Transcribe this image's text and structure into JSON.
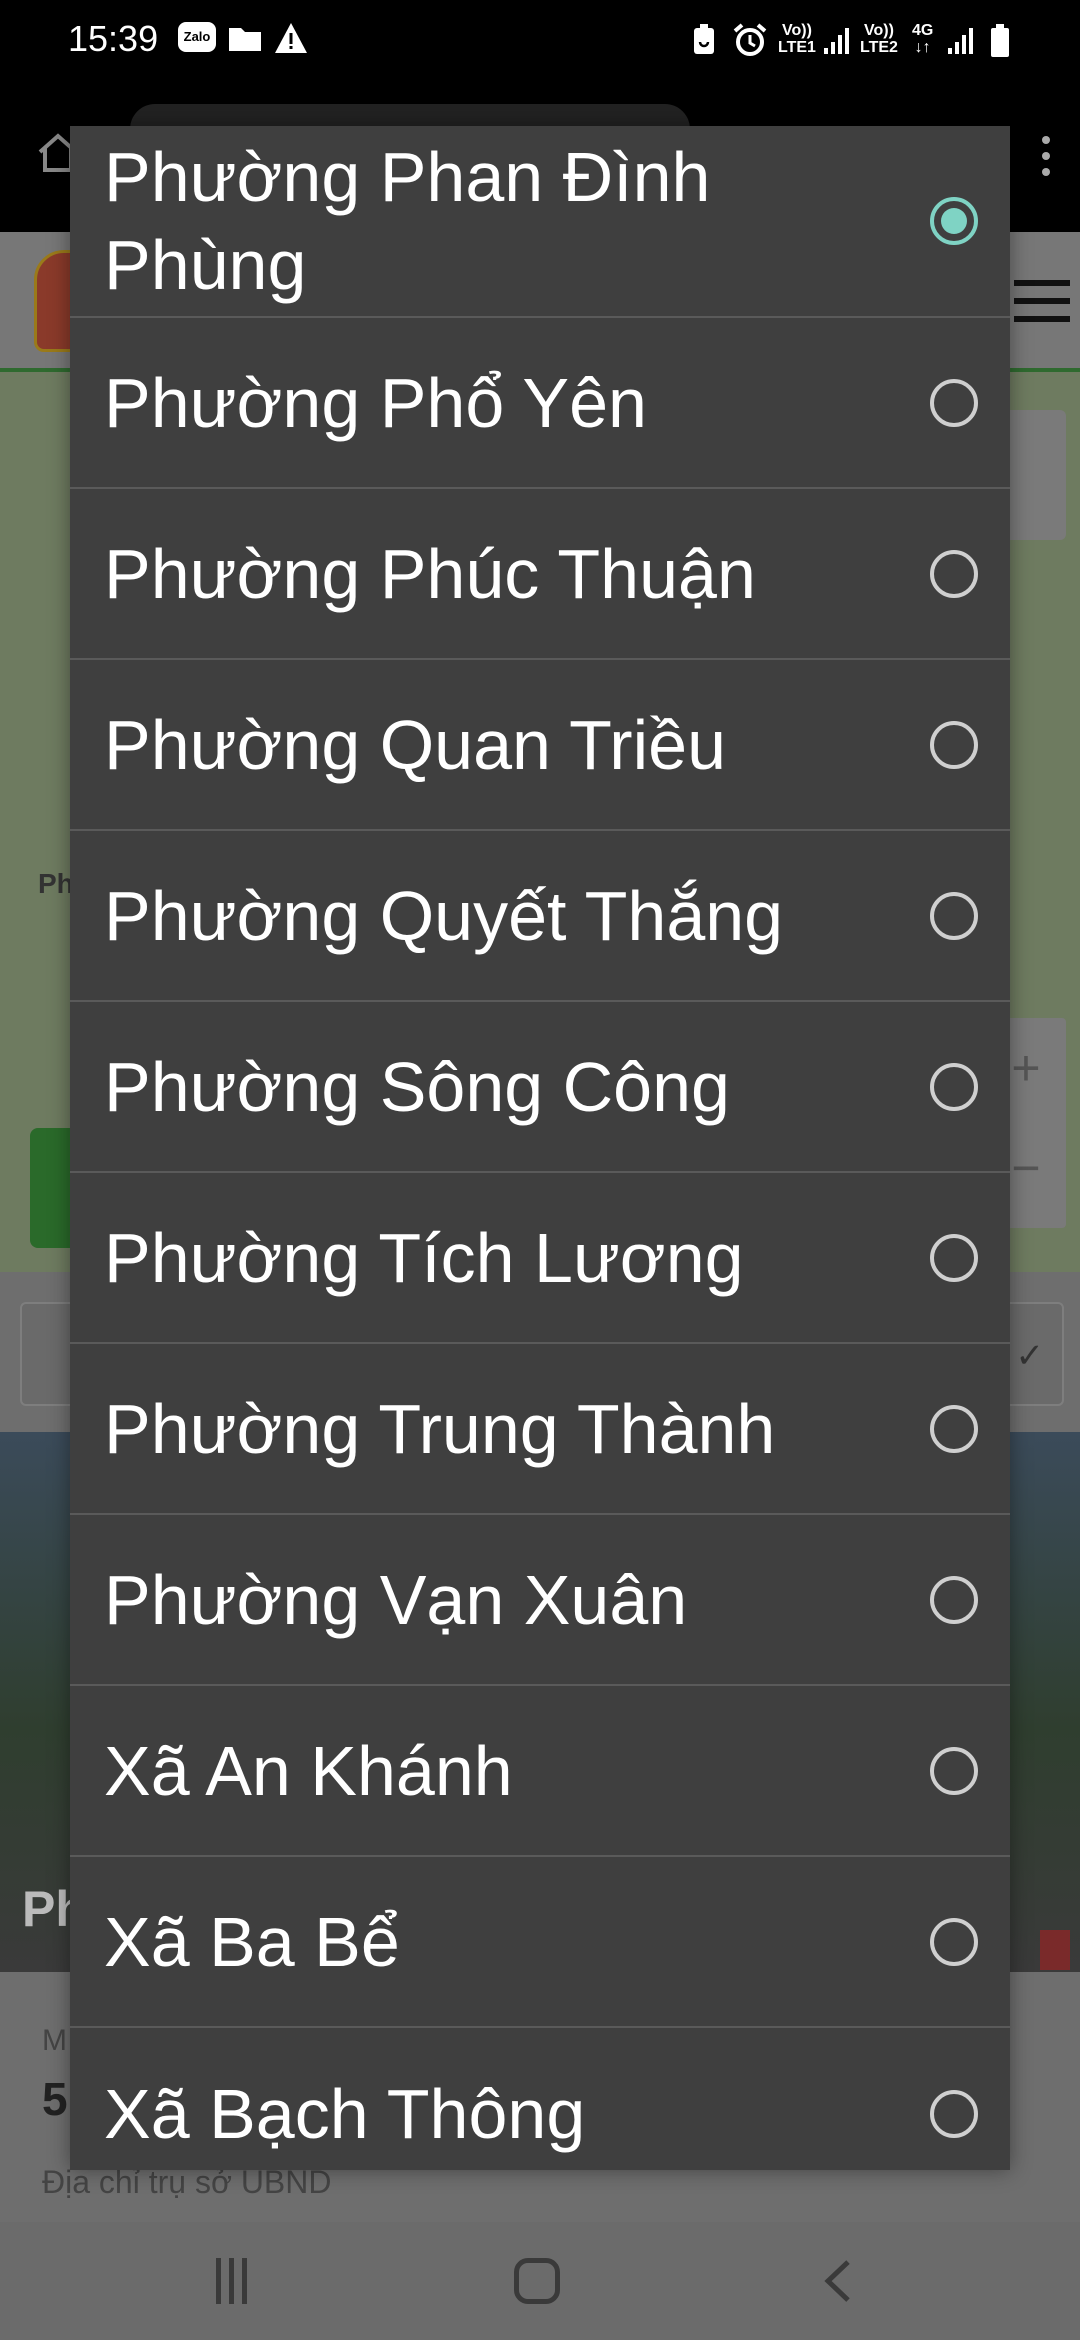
{
  "status_bar": {
    "time": "15:39",
    "notification_icons": [
      "zalo-icon",
      "folder-icon",
      "warning-icon"
    ],
    "right_icons": [
      "battery-saver-icon",
      "alarm-icon",
      "signal-icon",
      "signal-icon",
      "battery-icon"
    ],
    "sim1_label_top": "Vo))",
    "sim1_label_bottom": "LTE1",
    "sim2_label_top": "Vo))",
    "sim2_label_bottom": "LTE2",
    "network_type": "4G"
  },
  "background": {
    "map_label_partial": "Ph",
    "photo_title_partial": "Ph",
    "info_small_partial": "M",
    "info_big_partial": "5",
    "info_address_label": "Địa chỉ trụ sở UBND"
  },
  "dialog": {
    "options": [
      {
        "label": "Phường Phan Đình Phùng",
        "selected": true
      },
      {
        "label": "Phường Phổ Yên",
        "selected": false
      },
      {
        "label": "Phường Phúc Thuận",
        "selected": false
      },
      {
        "label": "Phường Quan Triều",
        "selected": false
      },
      {
        "label": "Phường Quyết Thắng",
        "selected": false
      },
      {
        "label": "Phường Sông Công",
        "selected": false
      },
      {
        "label": "Phường Tích Lương",
        "selected": false
      },
      {
        "label": "Phường Trung Thành",
        "selected": false
      },
      {
        "label": "Phường Vạn Xuân",
        "selected": false
      },
      {
        "label": "Xã An Khánh",
        "selected": false
      },
      {
        "label": "Xã Ba Bể",
        "selected": false
      },
      {
        "label": "Xã Bạch Thông",
        "selected": false
      }
    ]
  },
  "colors": {
    "dialog_background": "#3f3f3f",
    "radio_selected": "#7fd3c4",
    "radio_unselected": "#cfcfcf"
  },
  "nav_bar": [
    "recents-button",
    "home-button",
    "back-button"
  ]
}
